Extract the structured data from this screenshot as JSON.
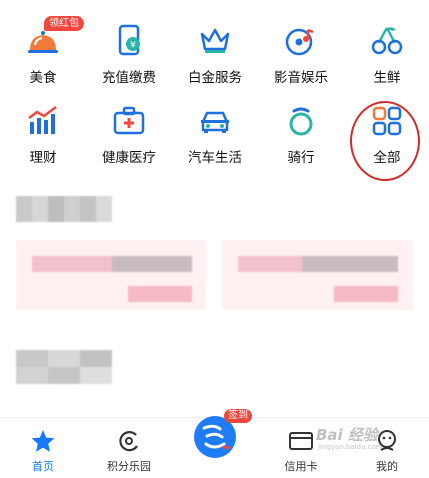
{
  "services": [
    {
      "label": "美食",
      "icon": "food-cloche-icon"
    },
    {
      "label": "充值缴费",
      "icon": "phone-recharge-icon"
    },
    {
      "label": "白金服务",
      "icon": "crown-icon"
    },
    {
      "label": "影音娱乐",
      "icon": "music-disc-icon"
    },
    {
      "label": "生鲜",
      "icon": "cherries-icon"
    },
    {
      "label": "理财",
      "icon": "chart-icon"
    },
    {
      "label": "健康医疗",
      "icon": "medical-kit-icon"
    },
    {
      "label": "汽车生活",
      "icon": "car-icon"
    },
    {
      "label": "骑行",
      "icon": "bike-icon"
    },
    {
      "label": "全部",
      "icon": "all-grid-icon"
    }
  ],
  "food_badge": "领红包",
  "tabs": [
    {
      "label": "首页",
      "icon": "star-icon",
      "active": true
    },
    {
      "label": "积分乐园",
      "icon": "points-icon",
      "active": false
    },
    {
      "label": "",
      "icon": "sign-in-icon",
      "active": false
    },
    {
      "label": "信用卡",
      "icon": "credit-card-icon",
      "active": false
    },
    {
      "label": "我的",
      "icon": "profile-icon",
      "active": false
    }
  ],
  "sign_badge": "签到",
  "watermark": {
    "text": "Bai 经验",
    "sub": "jingyan.baidu.com"
  },
  "colors": {
    "accent": "#1677ff",
    "badge": "#f0483e",
    "highlight_circle": "#d42a2a"
  }
}
